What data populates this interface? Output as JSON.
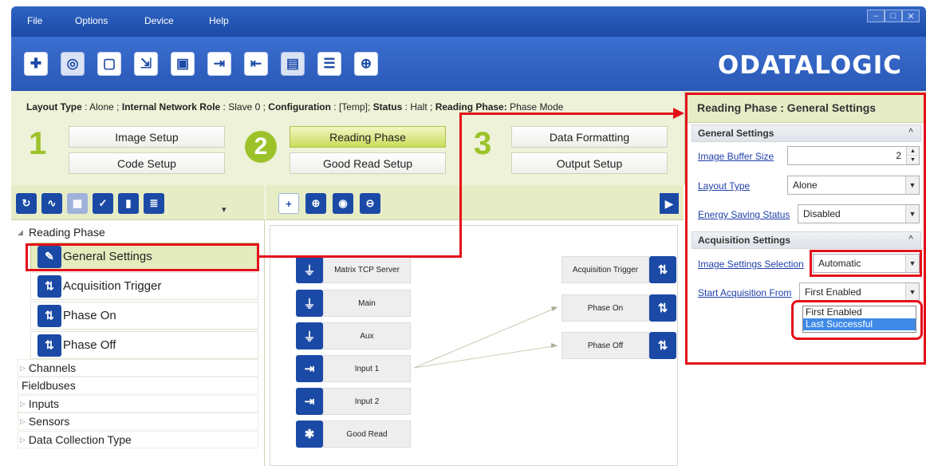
{
  "menu": [
    "File",
    "Options",
    "Device",
    "Help"
  ],
  "window_buttons": [
    "–",
    "□",
    "✕"
  ],
  "brand": "ODATALOGIC",
  "status": {
    "layout_type_label": "Layout Type",
    "layout_type_value": "Alone",
    "network_role_label": "Internal Network Role",
    "network_role_value": "Slave 0",
    "configuration_label": "Configuration",
    "configuration_value": "[Temp]",
    "status_label": "Status",
    "status_value": "Halt",
    "reading_phase_label": "Reading Phase:",
    "reading_phase_value": "Phase Mode"
  },
  "steps": {
    "step1": "1",
    "step2": "2",
    "step3": "3",
    "image_setup": "Image Setup",
    "code_setup": "Code Setup",
    "reading_phase": "Reading Phase",
    "good_read_setup": "Good Read Setup",
    "data_formatting": "Data Formatting",
    "output_setup": "Output Setup"
  },
  "tree": {
    "reading_phase": "Reading Phase",
    "general_settings": "General Settings",
    "acquisition_trigger": "Acquisition Trigger",
    "phase_on": "Phase On",
    "phase_off": "Phase Off",
    "channels": "Channels",
    "fieldbuses": "Fieldbuses",
    "inputs": "Inputs",
    "sensors": "Sensors",
    "data_collection_type": "Data Collection Type"
  },
  "canvas_nodes": {
    "matrix_tcp_server": "Matrix TCP Server",
    "main": "Main",
    "aux": "Aux",
    "input1": "Input 1",
    "input2": "Input 2",
    "good_read": "Good Read",
    "acquisition_trigger": "Acquisition Trigger",
    "phase_on": "Phase On",
    "phase_off": "Phase Off"
  },
  "right_panel": {
    "title": "Reading Phase : General Settings",
    "general_settings_header": "General Settings",
    "image_buffer_size_label": "Image Buffer Size",
    "image_buffer_size_value": "2",
    "layout_type_label": "Layout Type",
    "layout_type_value": "Alone",
    "energy_saving_label": "Energy Saving Status",
    "energy_saving_value": "Disabled",
    "acquisition_settings_header": "Acquisition Settings",
    "image_settings_selection_label": "Image Settings Selection",
    "image_settings_selection_value": "Automatic",
    "start_acquisition_from_label": "Start Acquisition From",
    "start_acquisition_from_value": "First Enabled",
    "dropdown_options": [
      "First Enabled",
      "Last Successful"
    ]
  },
  "colors": {
    "accent_blue": "#1b4aa6",
    "step_green": "#9cc22a",
    "callout_red": "#e3101a",
    "panel_green": "#eef2d8"
  }
}
